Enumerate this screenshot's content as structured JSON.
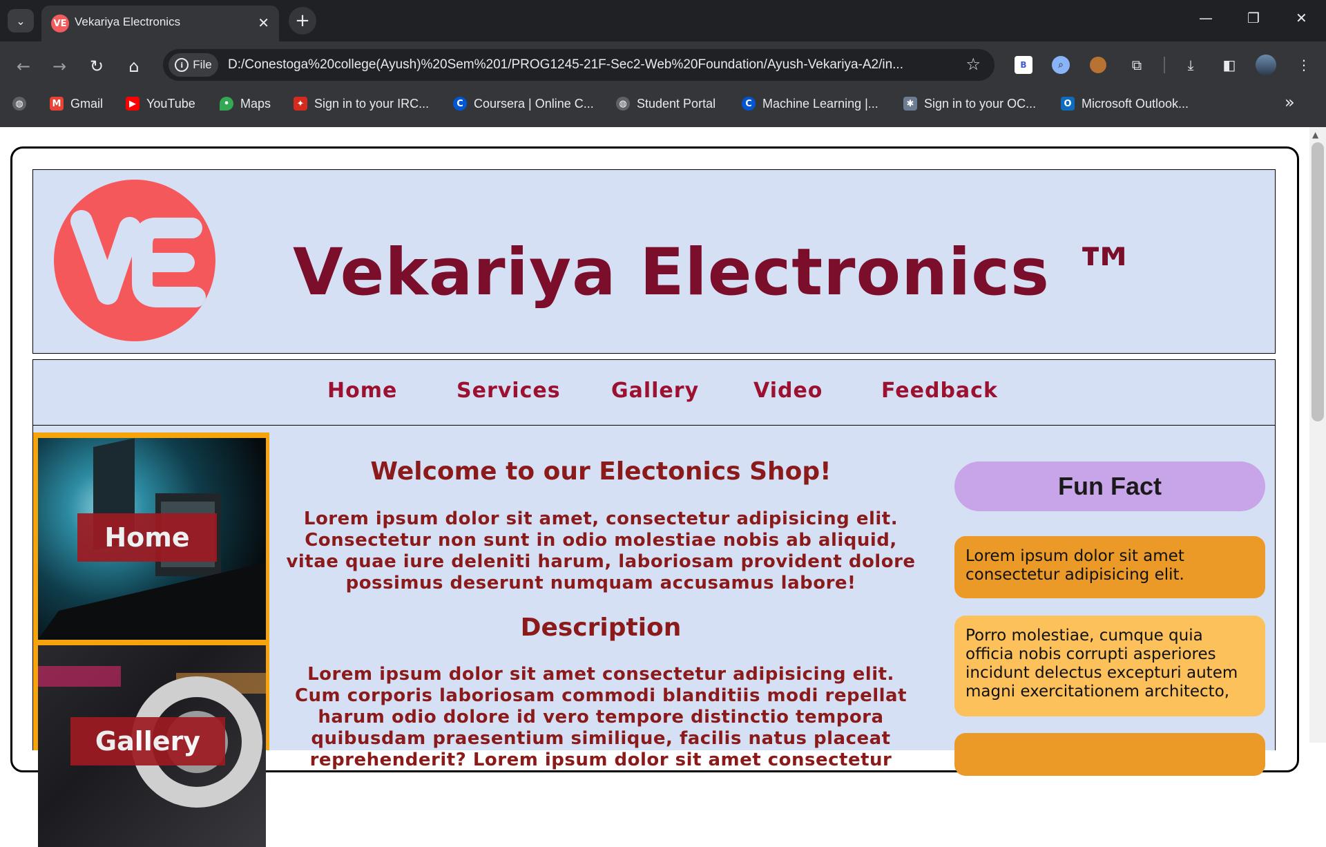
{
  "browser": {
    "tab_title": "Vekariya Electronics",
    "tab_favicon_text": "VE",
    "file_chip_label": "File",
    "url": "D:/Conestoga%20college(Ayush)%20Sem%201/PROG1245-21F-Sec2-Web%20Foundation/Ayush-Vekariya-A2/in...",
    "bookmarks": [
      {
        "label": "Gmail",
        "icon": "gmail-icon"
      },
      {
        "label": "YouTube",
        "icon": "youtube-icon"
      },
      {
        "label": "Maps",
        "icon": "maps-icon"
      },
      {
        "label": "Sign in to your IRC...",
        "icon": "maple-leaf-icon"
      },
      {
        "label": "Coursera | Online C...",
        "icon": "coursera-icon"
      },
      {
        "label": "Student Portal",
        "icon": "globe-icon"
      },
      {
        "label": "Machine Learning |...",
        "icon": "coursera-icon"
      },
      {
        "label": "Sign in to your OC...",
        "icon": "snowflake-icon"
      },
      {
        "label": "Microsoft Outlook...",
        "icon": "outlook-icon"
      }
    ],
    "extension_b_label": "B"
  },
  "site": {
    "logo_text": "VE",
    "title": "Vekariya Electronics ™",
    "nav": [
      "Home",
      "Services",
      "Gallery",
      "Video",
      "Feedback"
    ],
    "tiles": [
      "Home",
      "Gallery"
    ],
    "welcome_heading": "Welcome to our Electonics Shop!",
    "intro": "Lorem ipsum dolor sit amet, consectetur adipisicing elit. Consectetur non sunt in odio molestiae nobis ab aliquid, vitae quae iure deleniti harum, laboriosam provident dolore possimus deserunt numquam accusamus labore!",
    "description_heading": "Description",
    "description": "Lorem ipsum dolor sit amet consectetur adipisicing elit. Cum corporis laboriosam commodi blanditiis modi repellat harum odio dolore id vero tempore distinctio tempora quibusdam praesentium similique, facilis natus placeat reprehenderit? Lorem ipsum dolor sit amet consectetur",
    "fun_fact_title": "Fun Fact",
    "facts": [
      "Lorem ipsum dolor sit amet consectetur adipisicing elit.",
      "Porro molestiae, cumque quia officia nobis corrupti asperiores incidunt delectus excepturi autem magni exercitationem architecto,"
    ]
  },
  "colors": {
    "header_bg": "#d6e0f5",
    "title_color": "#7b0e2b",
    "nav_color": "#9c1030",
    "logo_red": "#f5585b",
    "tile_border": "#f5a50b",
    "fun_fact_pill": "#c8a4e8",
    "fact_orange": "#eb9a28",
    "fact_light_orange": "#fcc15a"
  }
}
